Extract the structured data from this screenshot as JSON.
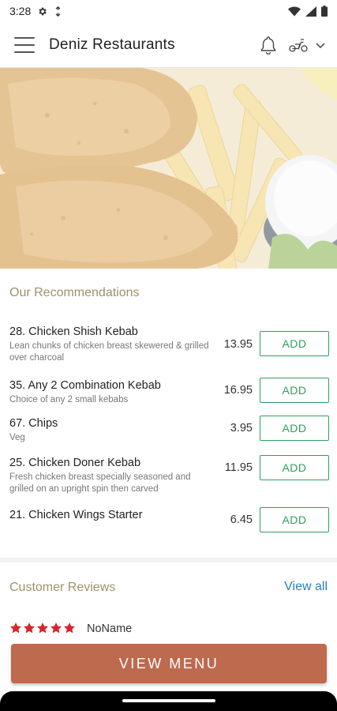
{
  "status_bar": {
    "time": "3:28",
    "icons": [
      "settings-icon",
      "data-saver-icon",
      "wifi-icon",
      "signal-icon",
      "battery-icon"
    ]
  },
  "app_bar": {
    "title": "Deniz Restaurants",
    "icons": [
      "menu-icon",
      "bell-icon",
      "scooter-icon",
      "chevron-down-icon"
    ]
  },
  "recommendations": {
    "title": "Our Recommendations",
    "items": [
      {
        "name": "28. Chicken Shish Kebab",
        "desc": "Lean chunks of chicken breast skewered & grilled over charcoal",
        "price": "13.95",
        "button": "ADD"
      },
      {
        "name": "35. Any 2 Combination Kebab",
        "desc": "Choice of any 2 small kebabs",
        "price": "16.95",
        "button": "ADD"
      },
      {
        "name": "67. Chips",
        "desc": "Veg",
        "price": "3.95",
        "button": "ADD"
      },
      {
        "name": "25. Chicken Doner Kebab",
        "desc": "Fresh chicken breast specially seasoned and grilled on an upright spin then carved",
        "price": "11.95",
        "button": "ADD"
      },
      {
        "name": "21. Chicken Wings Starter",
        "desc": "",
        "price": "6.45",
        "button": "ADD"
      }
    ]
  },
  "reviews": {
    "title": "Customer Reviews",
    "view_all": "View all",
    "first_review": {
      "rating": 5,
      "reviewer": "NoName"
    }
  },
  "view_menu_button": "VIEW MENU",
  "colors": {
    "accent_green": "#2ea05a",
    "section_title": "#a0906b",
    "link_blue": "#2a7fb8",
    "cta": "#bd6a4f",
    "star": "#d8252b"
  }
}
